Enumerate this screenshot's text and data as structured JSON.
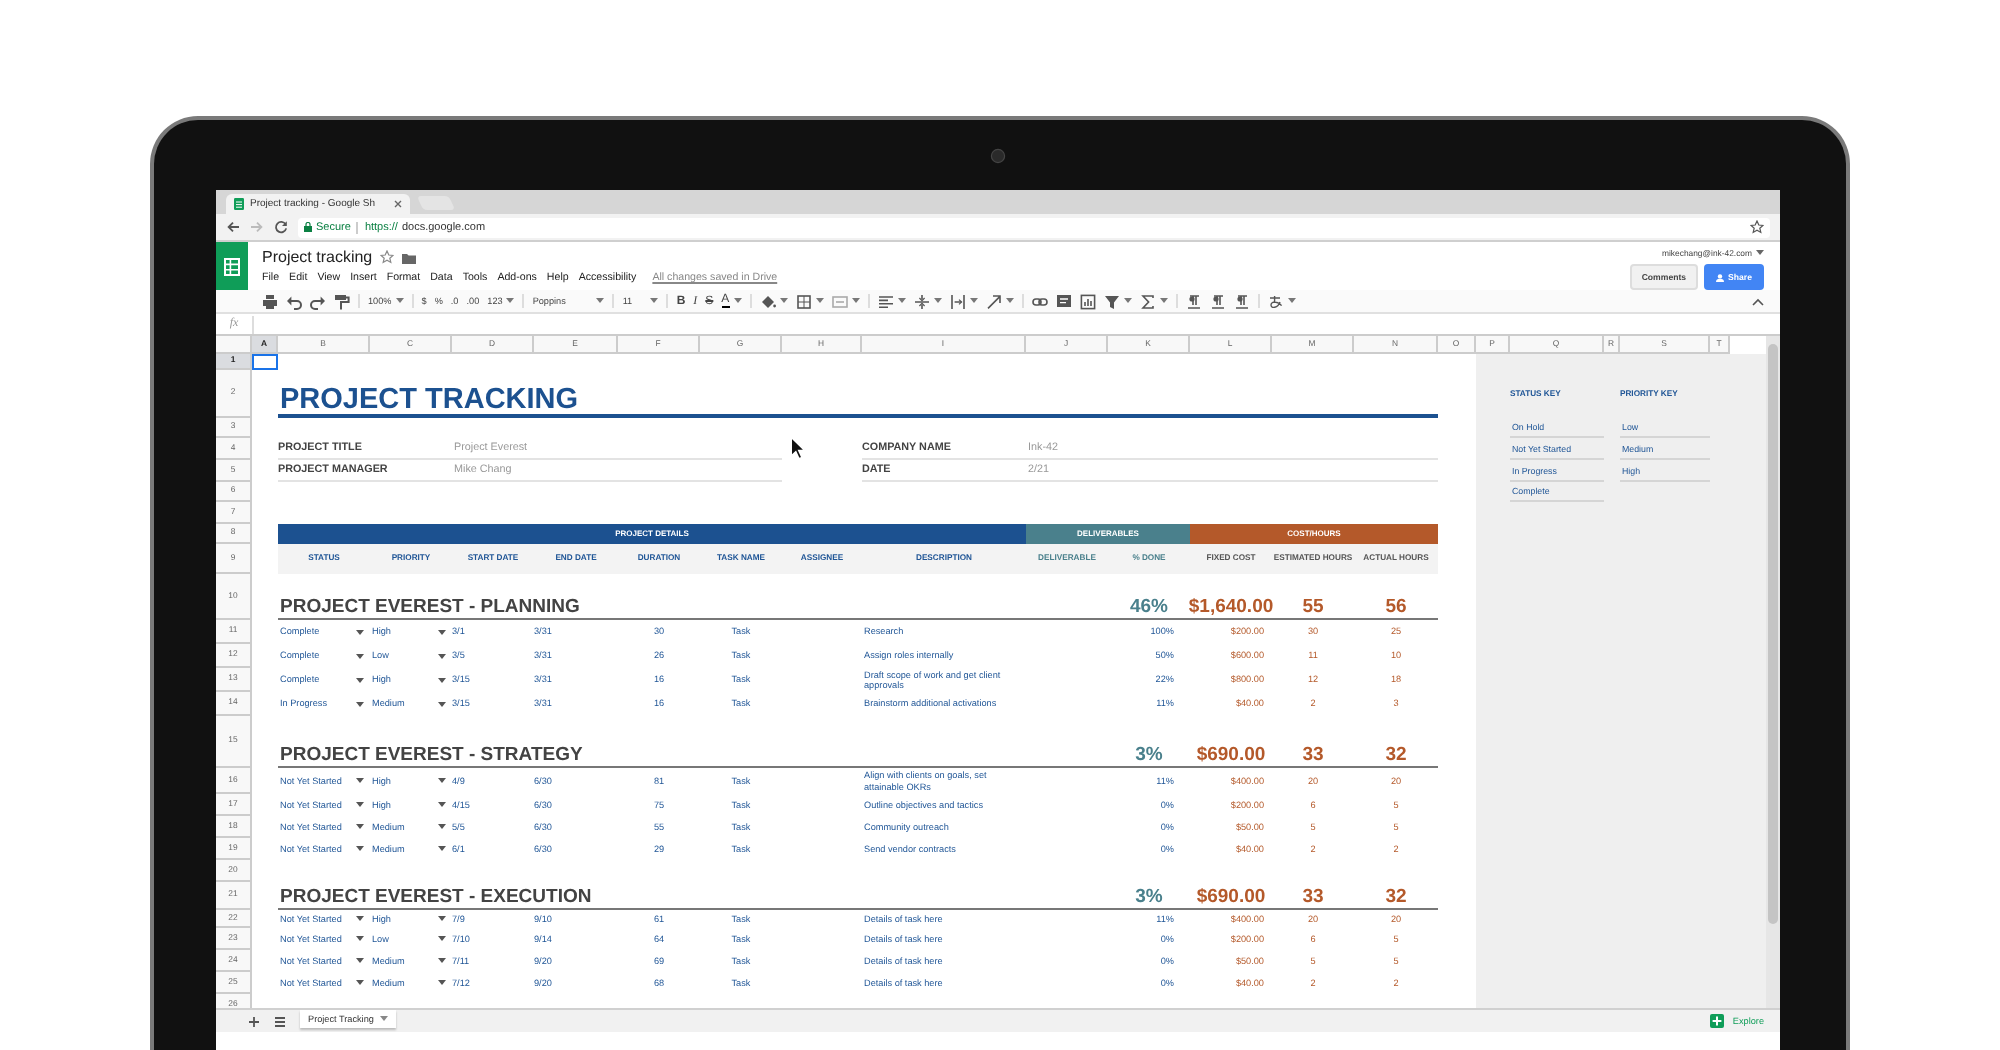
{
  "browser": {
    "tab_title": "Project tracking - Google Sh",
    "security": "Secure",
    "url_scheme": "https://",
    "url_host": "docs.google.com"
  },
  "app": {
    "title": "Project tracking",
    "menus": [
      "File",
      "Edit",
      "View",
      "Insert",
      "Format",
      "Data",
      "Tools",
      "Add-ons",
      "Help",
      "Accessibility"
    ],
    "save_status": "All changes saved in Drive",
    "account": "mikechang@ink-42.com",
    "comments": "Comments",
    "share": "Share"
  },
  "toolbar": {
    "zoom": "100%",
    "currency": "$",
    "percent": "%",
    "decimal_decrease": ".0",
    "decimal_increase": ".00",
    "more_formats": "123",
    "font": "Poppins",
    "font_size": "11",
    "bold": "B",
    "italic": "I",
    "strikethrough": "S",
    "text_color": "A"
  },
  "formula_bar": {
    "label": "fx"
  },
  "columns": [
    {
      "label": "A",
      "selected": true
    },
    {
      "label": "B",
      "selected": false
    },
    {
      "label": "C",
      "selected": false
    },
    {
      "label": "D",
      "selected": false
    },
    {
      "label": "E",
      "selected": false
    },
    {
      "label": "F",
      "selected": false
    },
    {
      "label": "G",
      "selected": false
    },
    {
      "label": "H",
      "selected": false
    },
    {
      "label": "I",
      "selected": false
    },
    {
      "label": "J",
      "selected": false
    },
    {
      "label": "K",
      "selected": false
    },
    {
      "label": "L",
      "selected": false
    },
    {
      "label": "M",
      "selected": false
    },
    {
      "label": "N",
      "selected": false
    },
    {
      "label": "O",
      "selected": false
    },
    {
      "label": "P",
      "selected": false
    },
    {
      "label": "Q",
      "selected": false
    },
    {
      "label": "R",
      "selected": false
    },
    {
      "label": "S",
      "selected": false
    },
    {
      "label": "T",
      "selected": false
    }
  ],
  "row_numbers": [
    {
      "label": "1",
      "selected": true
    },
    {
      "label": "2",
      "selected": false
    },
    {
      "label": "3",
      "selected": false
    },
    {
      "label": "4",
      "selected": false
    },
    {
      "label": "5",
      "selected": false
    },
    {
      "label": "6",
      "selected": false
    },
    {
      "label": "7",
      "selected": false
    },
    {
      "label": "8",
      "selected": false
    },
    {
      "label": "9",
      "selected": false
    },
    {
      "label": "10",
      "selected": false
    },
    {
      "label": "11",
      "selected": false
    },
    {
      "label": "12",
      "selected": false
    },
    {
      "label": "13",
      "selected": false
    },
    {
      "label": "14",
      "selected": false
    },
    {
      "label": "15",
      "selected": false
    },
    {
      "label": "16",
      "selected": false
    },
    {
      "label": "17",
      "selected": false
    },
    {
      "label": "18",
      "selected": false
    },
    {
      "label": "19",
      "selected": false
    },
    {
      "label": "20",
      "selected": false
    },
    {
      "label": "21",
      "selected": false
    },
    {
      "label": "22",
      "selected": false
    },
    {
      "label": "23",
      "selected": false
    },
    {
      "label": "24",
      "selected": false
    },
    {
      "label": "25",
      "selected": false
    },
    {
      "label": "26",
      "selected": false
    }
  ],
  "sheet": {
    "title": "PROJECT TRACKING",
    "info": [
      {
        "label": "PROJECT TITLE",
        "value": "Project Everest"
      },
      {
        "label": "PROJECT MANAGER",
        "value": "Mike Chang"
      },
      {
        "label": "COMPANY NAME",
        "value": "Ink-42"
      },
      {
        "label": "DATE",
        "value": "2/21"
      }
    ],
    "bands": [
      {
        "label": "PROJECT DETAILS",
        "color": "#1c5190"
      },
      {
        "label": "DELIVERABLES",
        "color": "#4a808c"
      },
      {
        "label": "COST/HOURS",
        "color": "#b4592a"
      }
    ],
    "headers": [
      "STATUS",
      "PRIORITY",
      "START DATE",
      "END DATE",
      "DURATION",
      "TASK NAME",
      "ASSIGNEE",
      "DESCRIPTION",
      "DELIVERABLE",
      "% DONE",
      "FIXED COST",
      "ESTIMATED HOURS",
      "ACTUAL HOURS"
    ],
    "sections": [
      {
        "title": "PROJECT EVEREST - PLANNING",
        "done": "46%",
        "cost": "$1,640.00",
        "estimated": "55",
        "actual": "56",
        "tasks": [
          {
            "status": "Complete",
            "priority": "High",
            "start": "3/1",
            "end": "3/31",
            "duration": "30",
            "task": "Task",
            "description": "Research",
            "done": "100%",
            "cost": "$200.00",
            "estimated": "30",
            "actual": "25"
          },
          {
            "status": "Complete",
            "priority": "Low",
            "start": "3/5",
            "end": "3/31",
            "duration": "26",
            "task": "Task",
            "description": "Assign roles internally",
            "done": "50%",
            "cost": "$600.00",
            "estimated": "11",
            "actual": "10"
          },
          {
            "status": "Complete",
            "priority": "High",
            "start": "3/15",
            "end": "3/31",
            "duration": "16",
            "task": "Task",
            "description": "Draft scope of work and get client approvals",
            "done": "22%",
            "cost": "$800.00",
            "estimated": "12",
            "actual": "18"
          },
          {
            "status": "In Progress",
            "priority": "Medium",
            "start": "3/15",
            "end": "3/31",
            "duration": "16",
            "task": "Task",
            "description": "Brainstorm additional activations",
            "done": "11%",
            "cost": "$40.00",
            "estimated": "2",
            "actual": "3"
          }
        ]
      },
      {
        "title": "PROJECT EVEREST - STRATEGY",
        "done": "3%",
        "cost": "$690.00",
        "estimated": "33",
        "actual": "32",
        "tasks": [
          {
            "status": "Not Yet Started",
            "priority": "High",
            "start": "4/9",
            "end": "6/30",
            "duration": "81",
            "task": "Task",
            "description": "Align with clients on goals, set attainable OKRs",
            "done": "11%",
            "cost": "$400.00",
            "estimated": "20",
            "actual": "20"
          },
          {
            "status": "Not Yet Started",
            "priority": "High",
            "start": "4/15",
            "end": "6/30",
            "duration": "75",
            "task": "Task",
            "description": "Outline objectives and tactics",
            "done": "0%",
            "cost": "$200.00",
            "estimated": "6",
            "actual": "5"
          },
          {
            "status": "Not Yet Started",
            "priority": "Medium",
            "start": "5/5",
            "end": "6/30",
            "duration": "55",
            "task": "Task",
            "description": "Community outreach",
            "done": "0%",
            "cost": "$50.00",
            "estimated": "5",
            "actual": "5"
          },
          {
            "status": "Not Yet Started",
            "priority": "Medium",
            "start": "6/1",
            "end": "6/30",
            "duration": "29",
            "task": "Task",
            "description": "Send vendor contracts",
            "done": "0%",
            "cost": "$40.00",
            "estimated": "2",
            "actual": "2"
          }
        ]
      },
      {
        "title": "PROJECT EVEREST - EXECUTION",
        "done": "3%",
        "cost": "$690.00",
        "estimated": "33",
        "actual": "32",
        "tasks": [
          {
            "status": "Not Yet Started",
            "priority": "High",
            "start": "7/9",
            "end": "9/10",
            "duration": "61",
            "task": "Task",
            "description": "Details of task here",
            "done": "11%",
            "cost": "$400.00",
            "estimated": "20",
            "actual": "20"
          },
          {
            "status": "Not Yet Started",
            "priority": "Low",
            "start": "7/10",
            "end": "9/14",
            "duration": "64",
            "task": "Task",
            "description": "Details of task here",
            "done": "0%",
            "cost": "$200.00",
            "estimated": "6",
            "actual": "5"
          },
          {
            "status": "Not Yet Started",
            "priority": "Medium",
            "start": "7/11",
            "end": "9/20",
            "duration": "69",
            "task": "Task",
            "description": "Details of task here",
            "done": "0%",
            "cost": "$50.00",
            "estimated": "5",
            "actual": "5"
          },
          {
            "status": "Not Yet Started",
            "priority": "Medium",
            "start": "7/12",
            "end": "9/20",
            "duration": "68",
            "task": "Task",
            "description": "Details of task here",
            "done": "0%",
            "cost": "$40.00",
            "estimated": "2",
            "actual": "2"
          }
        ]
      }
    ],
    "status_key": {
      "title": "STATUS KEY",
      "items": [
        "On Hold",
        "Not Yet Started",
        "In Progress",
        "Complete"
      ]
    },
    "priority_key": {
      "title": "PRIORITY KEY",
      "items": [
        "Low",
        "Medium",
        "High"
      ]
    }
  },
  "sheet_tabs": [
    {
      "label": "Project Tracking",
      "selected": true
    }
  ],
  "explore": "Explore"
}
